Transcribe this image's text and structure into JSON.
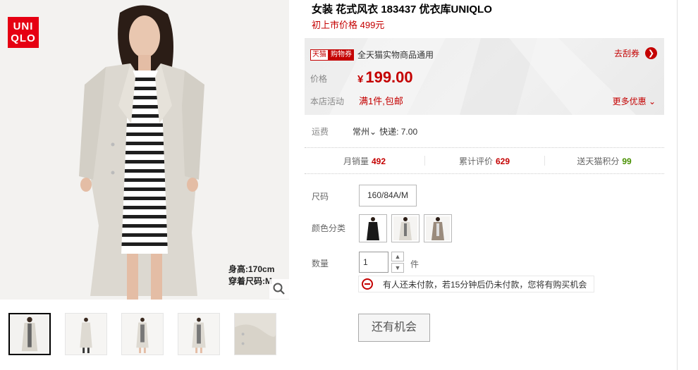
{
  "product": {
    "title": "女装 花式风衣 183437 优衣库UNIQLO",
    "original_price_label": "初上市价格 499元"
  },
  "gallery": {
    "logo_text_line1": "UNI",
    "logo_text_line2": "QLO",
    "caption_height": "身高:170cm",
    "caption_size": "穿着尺码:M",
    "thumbnail_count": 5
  },
  "price_box": {
    "tag_tmall": "天猫",
    "tag_coupon": "购物券",
    "coupon_text": "全天猫实物商品通用",
    "get_coupon": "去刮券",
    "price_label": "价格",
    "currency": "¥",
    "price": "199.00",
    "activity_label": "本店活动",
    "activity_text": "满1件,包邮",
    "more_offers": "更多优惠"
  },
  "shipping": {
    "label": "运费",
    "city": "常州",
    "method": "快递: 7.00"
  },
  "stats": {
    "monthly_sales_label": "月销量",
    "monthly_sales": "492",
    "reviews_label": "累计评价",
    "reviews": "629",
    "points_label": "送天猫积分",
    "points": "99"
  },
  "options": {
    "size_label": "尺码",
    "size_value": "160/84A/M",
    "color_label": "颜色分类",
    "colors": [
      "black",
      "light-beige",
      "taupe"
    ],
    "qty_label": "数量",
    "qty_value": "1",
    "qty_unit": "件"
  },
  "notice": {
    "text": "有人还未付款，若15分钟后仍未付款，您将有购买机会"
  },
  "action": {
    "button_label": "还有机会"
  },
  "colors": {
    "accent_red": "#c40000",
    "brand_red": "#e60012",
    "points_green": "#489000"
  }
}
